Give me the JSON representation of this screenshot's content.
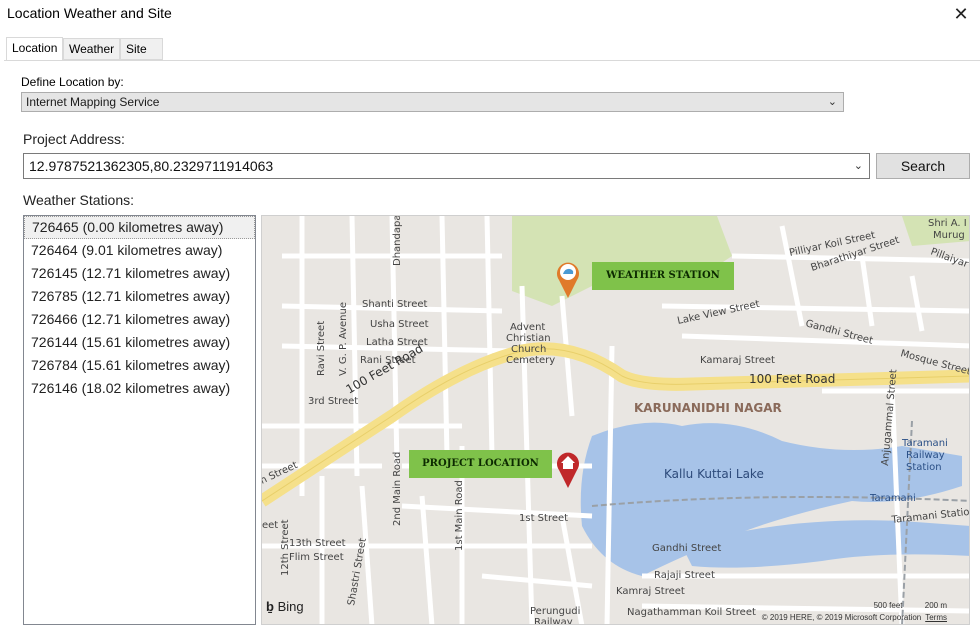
{
  "window": {
    "title": "Location Weather and Site",
    "close_glyph": "✕"
  },
  "tabs": [
    {
      "label": "Location",
      "active": true
    },
    {
      "label": "Weather",
      "active": false
    },
    {
      "label": "Site",
      "active": false
    }
  ],
  "location": {
    "define_label": "Define Location by:",
    "define_value": "Internet Mapping Service",
    "address_label": "Project Address:",
    "address_value": "12.9787521362305,80.2329711914063",
    "search_label": "Search",
    "stations_label": "Weather Stations:"
  },
  "stations": [
    "726465 (0.00 kilometres away)",
    "726464 (9.01 kilometres away)",
    "726145 (12.71 kilometres away)",
    "726785 (12.71 kilometres away)",
    "726466 (12.71 kilometres away)",
    "726144 (15.61 kilometres away)",
    "726784 (15.61 kilometres away)",
    "726146 (18.02 kilometres away)"
  ],
  "map": {
    "weather_tag": "WEATHER STATION",
    "project_tag": "PROJECT LOCATION",
    "bing": "Bing",
    "scale_feet": "500 feet",
    "scale_m": "200 m",
    "copyright": "© 2019 HERE, © 2019 Microsoft Corporation",
    "terms": "Terms",
    "labels": {
      "road_100ft_a": "100 Feet Road",
      "road_100ft_b": "100 Feet Road",
      "karunanidhi": "KARUNANIDHI NAGAR",
      "lake": "Kallu Kuttai Lake",
      "church1": "Advent",
      "church2": "Christian",
      "church3": "Church",
      "church4": "Cemetery",
      "shanti": "Shanti Street",
      "usha": "Usha Street",
      "latha": "Latha Street",
      "rani": "Rani Street",
      "third": "3rd Street",
      "first": "1st Street",
      "thirteenth": "13th Street",
      "flim": "Flim Street",
      "gandhi1": "Gandhi Street",
      "gandhi2": "Gandhi Street",
      "rajaji": "Rajaji Street",
      "kamraj1": "Kamraj Street",
      "kamraj2": "Kamaraj Street",
      "nagathamman": "Nagathamman Koil Street",
      "lakeview": "Lake View Street",
      "mosque": "Mosque Street",
      "pilliyar": "Pilliyar Koil Street",
      "bharathiyar": "Bharathiyar Street",
      "pillaiyar2": "Pillaiyar K",
      "dhandapani": "Dhandapa",
      "ravi": "Ravi Street",
      "vgp": "V. G. P. Avenue",
      "second_main": "2nd Main Road",
      "first_main": "1st Main Road",
      "twelfth": "12th Street",
      "shastri": "Shastri Street",
      "anjugam": "Anjugammal Street",
      "taramani1": "Taramani",
      "taramani2": "Railway",
      "taramani3": "Station",
      "taramani_small": "Taramani",
      "taramani_st": "Taramani Station R",
      "perungudi1": "Perungudi",
      "perungudi2": "Railway",
      "shri1": "Shri A. I",
      "shri2": "Murug",
      "h_street": "h Street",
      "eet": "eet"
    }
  }
}
